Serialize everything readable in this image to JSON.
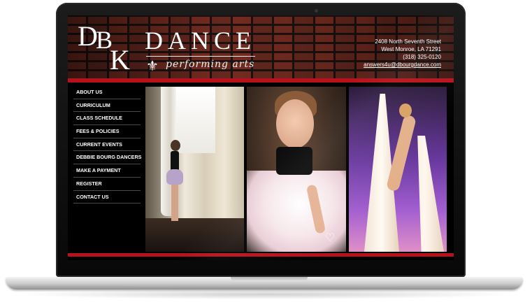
{
  "logo": {
    "letter_d": "D",
    "letter_b": "B",
    "letter_k": "K",
    "wordmark": "DANCE",
    "tagline": "performing arts",
    "emblem": "fleur-de-lis"
  },
  "contact": {
    "street": "2408 North Seventh Street",
    "city": "West Monroe, LA 71291",
    "phone": "(318) 325-0120",
    "email": "answers4u@dbourgdance.com"
  },
  "nav": {
    "items": [
      {
        "label": "ABOUT US"
      },
      {
        "label": "CURRICULUM"
      },
      {
        "label": "CLASS SCHEDULE"
      },
      {
        "label": "FEES & POLICIES"
      },
      {
        "label": "CURRENT EVENTS"
      },
      {
        "label": "DEBBIE BOURG DANCERS"
      },
      {
        "label": "MAKE A PAYMENT"
      },
      {
        "label": "REGISTER"
      },
      {
        "label": "CONTACT US"
      }
    ]
  },
  "colors": {
    "accent_red": "#b5121b",
    "background": "#000000",
    "nav_text": "#ffffff"
  },
  "icons": {
    "fleur": "fleur-de-lis-icon",
    "heart_mark": "heart-signature-icon"
  }
}
